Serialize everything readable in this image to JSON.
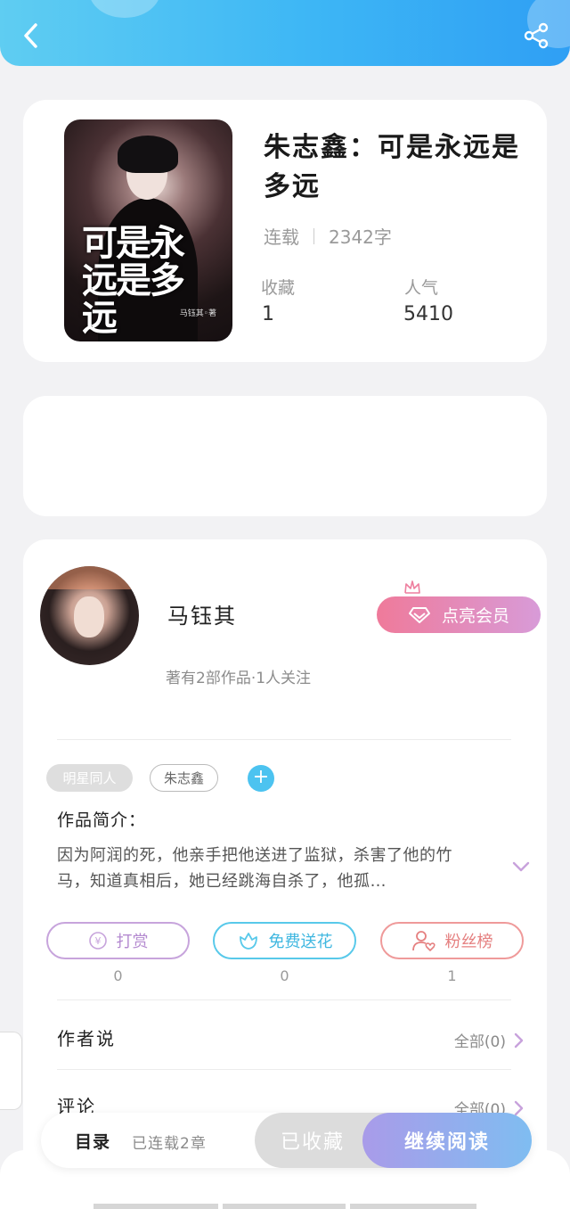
{
  "header": {
    "back_icon": "chevron-left-icon",
    "share_icon": "share-icon"
  },
  "book": {
    "cover_title": "可是永远是多远",
    "cover_author": "马钰其◦著",
    "title": "朱志鑫：可是永远是多远",
    "status": "连载",
    "word_count": "2342字",
    "favorites_label": "收藏",
    "favorites_value": "1",
    "popularity_label": "人气",
    "popularity_value": "5410"
  },
  "author": {
    "name": "马钰其",
    "works": "著有2部作品·1人关注",
    "vip_label": "点亮会员"
  },
  "tags": [
    "明星同人",
    "朱志鑫"
  ],
  "intro": {
    "label": "作品简介：",
    "text": "因为阿润的死，他亲手把他送进了监狱，杀害了他的竹马，知道真相后，她已经跳海自杀了，他孤…"
  },
  "actions": {
    "reward": {
      "label": "打赏",
      "count": "0"
    },
    "flower": {
      "label": "免费送花",
      "count": "0"
    },
    "fans": {
      "label": "粉丝榜",
      "count": "1"
    }
  },
  "sections": {
    "author_says": {
      "title": "作者说",
      "more": "全部(0)"
    },
    "comments": {
      "title": "评论",
      "more": "全部(0)"
    }
  },
  "bottom_bar": {
    "toc": "目录",
    "serial": "已连载2章",
    "collected": "已收藏",
    "continue": "继续阅读"
  },
  "colors": {
    "header_gradient_start": "#5fcdf2",
    "header_gradient_end": "#2f9ff4",
    "vip_gradient_start": "#ef7a9a",
    "vip_gradient_end": "#d89bd8",
    "read_gradient_start": "#a99be9",
    "read_gradient_end": "#7fbdf1"
  }
}
